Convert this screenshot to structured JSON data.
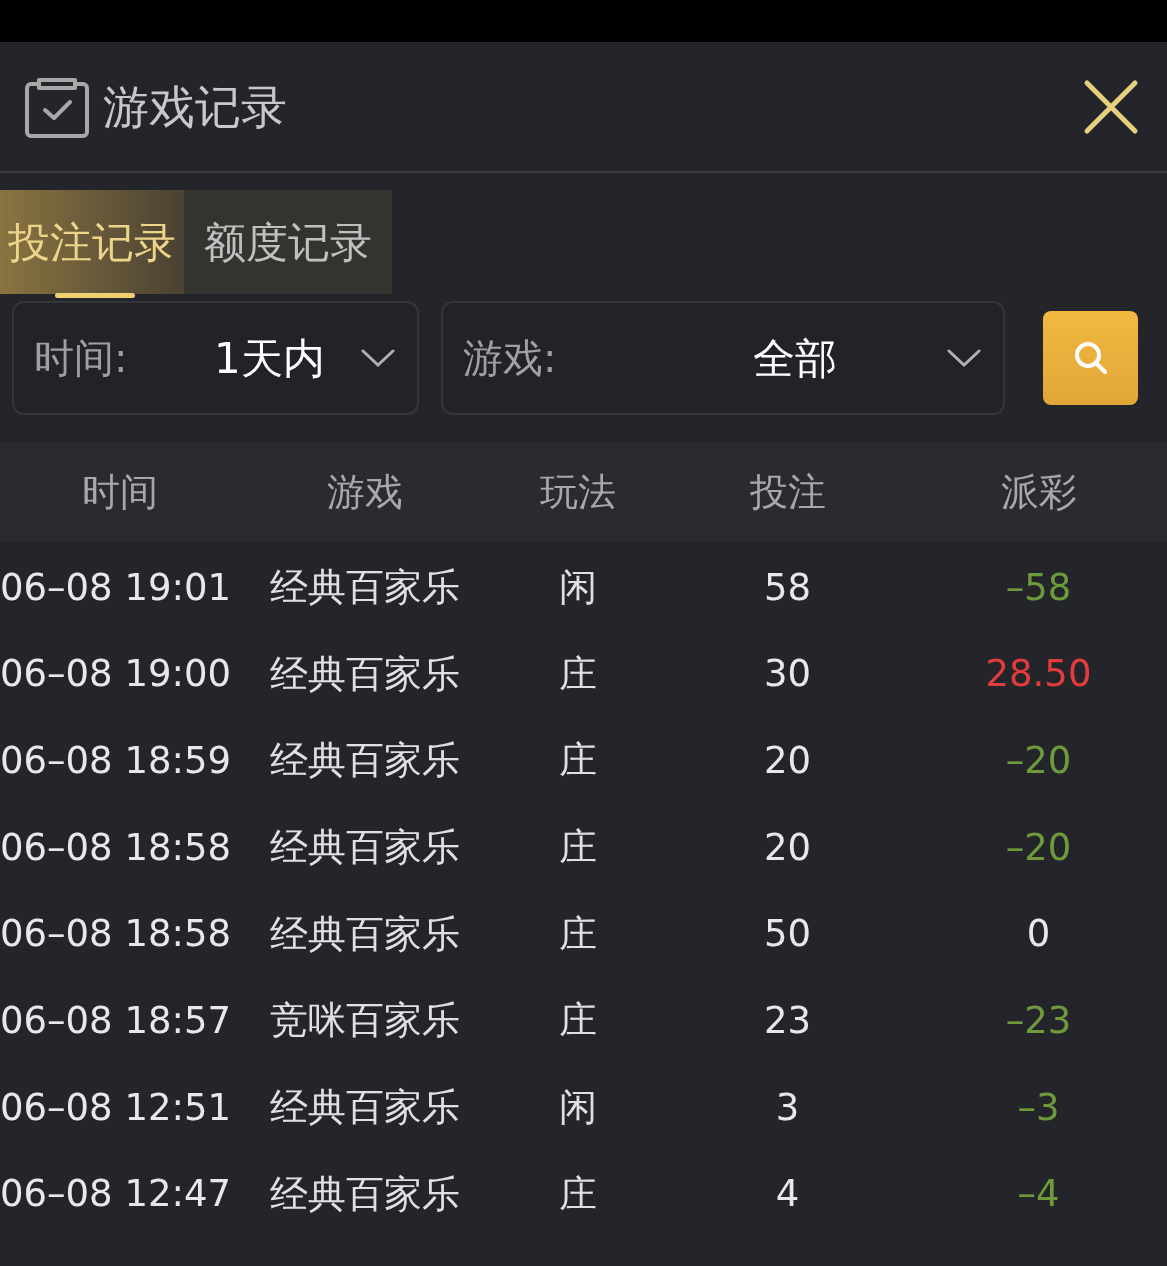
{
  "window": {
    "title": "游戏记录"
  },
  "tabs": [
    {
      "label": "投注记录",
      "selected": true
    },
    {
      "label": "额度记录",
      "selected": false
    }
  ],
  "filters": [
    {
      "label": "时间:",
      "value": "1天内"
    },
    {
      "label": "游戏:",
      "value": "全部"
    }
  ],
  "table": {
    "columns": [
      "时间",
      "游戏",
      "玩法",
      "投注",
      "派彩"
    ],
    "rows": [
      {
        "time": "06–08 19:01",
        "game": "经典百家乐",
        "play": "闲",
        "bet": "58",
        "payout": "–58",
        "color": "#6e9a3c"
      },
      {
        "time": "06–08 19:00",
        "game": "经典百家乐",
        "play": "庄",
        "bet": "30",
        "payout": "28.50",
        "color": "#e23c3c"
      },
      {
        "time": "06–08 18:59",
        "game": "经典百家乐",
        "play": "庄",
        "bet": "20",
        "payout": "–20",
        "color": "#6e9a3c"
      },
      {
        "time": "06–08 18:58",
        "game": "经典百家乐",
        "play": "庄",
        "bet": "20",
        "payout": "–20",
        "color": "#6e9a3c"
      },
      {
        "time": "06–08 18:58",
        "game": "经典百家乐",
        "play": "庄",
        "bet": "50",
        "payout": "0",
        "color": "#e8e8e8"
      },
      {
        "time": "06–08 18:57",
        "game": "竞咪百家乐",
        "play": "庄",
        "bet": "23",
        "payout": "–23",
        "color": "#6e9a3c"
      },
      {
        "time": "06–08 12:51",
        "game": "经典百家乐",
        "play": "闲",
        "bet": "3",
        "payout": "–3",
        "color": "#6e9a3c"
      },
      {
        "time": "06–08 12:47",
        "game": "经典百家乐",
        "play": "庄",
        "bet": "4",
        "payout": "–4",
        "color": "#6e9a3c"
      }
    ]
  }
}
